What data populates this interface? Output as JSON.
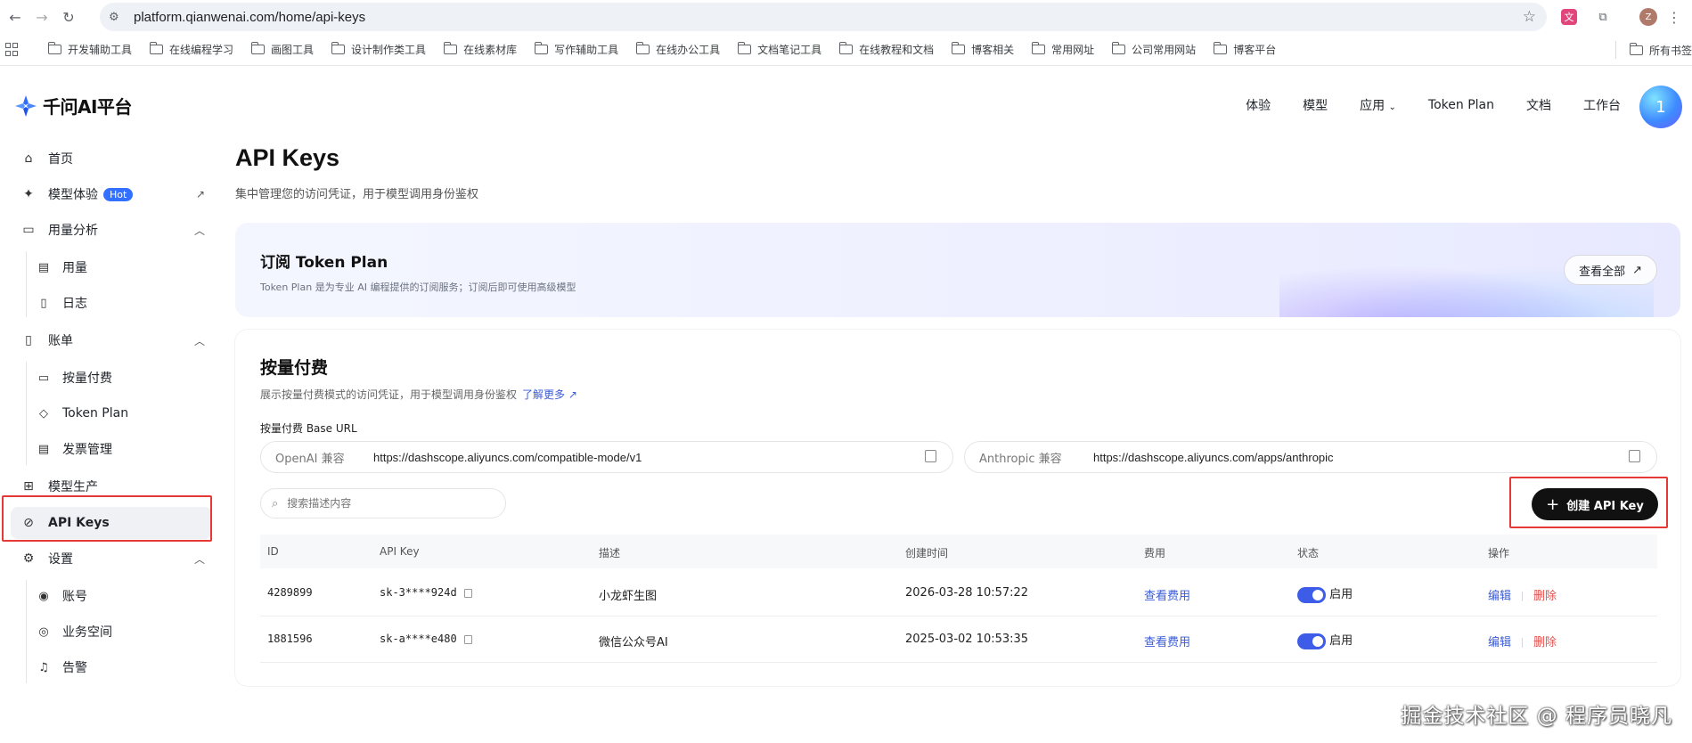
{
  "browser": {
    "url": "platform.qianwenai.com/home/api-keys",
    "profile_initial": "Z",
    "bookmarks": [
      "开发辅助工具",
      "在线编程学习",
      "画图工具",
      "设计制作类工具",
      "在线素材库",
      "写作辅助工具",
      "在线办公工具",
      "文档笔记工具",
      "在线教程和文档",
      "博客相关",
      "常用网址",
      "公司常用网站",
      "博客平台"
    ],
    "all_bookmarks": "所有书签"
  },
  "header": {
    "logo": "千问AI平台",
    "nav": [
      "体验",
      "模型",
      "应用",
      "Token Plan",
      "文档",
      "工作台"
    ],
    "avatar_initial": "1"
  },
  "sidebar": {
    "home": "首页",
    "model_experience": "模型体验",
    "hot_badge": "Hot",
    "usage_analysis": "用量分析",
    "usage": "用量",
    "logs": "日志",
    "billing": "账单",
    "pay_as_you_go": "按量付费",
    "token_plan": "Token Plan",
    "invoice": "发票管理",
    "model_production": "模型生产",
    "api_keys": "API Keys",
    "settings": "设置",
    "account": "账号",
    "workspace": "业务空间",
    "alerts": "告警"
  },
  "main": {
    "title": "API Keys",
    "subtitle": "集中管理您的访问凭证，用于模型调用身份鉴权",
    "banner": {
      "title": "订阅 Token Plan",
      "desc": "Token Plan 是为专业 AI 编程提供的订阅服务；订阅后即可使用高级模型",
      "button": "查看全部"
    },
    "section": {
      "title": "按量付费",
      "desc": "展示按量付费模式的访问凭证，用于模型调用身份鉴权",
      "learn_more": "了解更多",
      "base_url_label": "按量付费 Base URL",
      "openai_tag": "OpenAI 兼容",
      "openai_url": "https://dashscope.aliyuncs.com/compatible-mode/v1",
      "anthropic_tag": "Anthropic 兼容",
      "anthropic_url": "https://dashscope.aliyuncs.com/apps/anthropic",
      "search_placeholder": "搜索描述内容",
      "create_button": "创建 API Key"
    },
    "table": {
      "headers": [
        "ID",
        "API Key",
        "描述",
        "创建时间",
        "费用",
        "状态",
        "操作"
      ],
      "rows": [
        {
          "id": "4289899",
          "key": "sk-3****924d",
          "desc": "小龙虾生图",
          "created": "2026-03-28 10:57:22",
          "fee": "查看费用",
          "status": "启用",
          "edit": "编辑",
          "delete": "删除"
        },
        {
          "id": "1881596",
          "key": "sk-a****e480",
          "desc": "微信公众号AI",
          "created": "2025-03-02 10:53:35",
          "fee": "查看费用",
          "status": "启用",
          "edit": "编辑",
          "delete": "删除"
        }
      ]
    }
  },
  "watermark": "掘金技术社区 @ 程序员晓凡",
  "colors": {
    "accent": "#3370ff",
    "link": "#3a5bd9",
    "danger": "#e2524f",
    "highlight_box": "#e53935",
    "primary_button": "#111111"
  }
}
